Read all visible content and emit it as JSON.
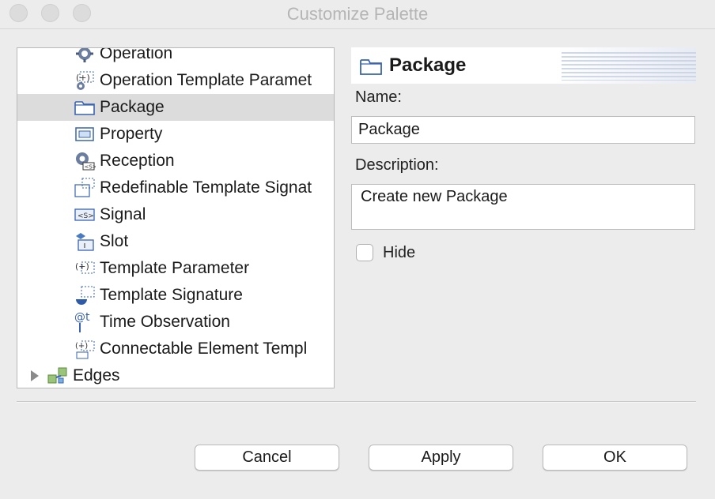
{
  "window": {
    "title": "Customize Palette"
  },
  "tree": {
    "items": [
      {
        "label": "Operation",
        "icon": "operation-gear-icon"
      },
      {
        "label": "Operation Template Paramet",
        "icon": "operation-template-parameter-icon"
      },
      {
        "label": "Package",
        "icon": "package-folder-icon",
        "selected": true
      },
      {
        "label": "Property",
        "icon": "property-icon"
      },
      {
        "label": "Reception",
        "icon": "reception-gear-icon"
      },
      {
        "label": "Redefinable Template Signat",
        "icon": "redefinable-template-signature-icon"
      },
      {
        "label": "Signal",
        "icon": "signal-icon"
      },
      {
        "label": "Slot",
        "icon": "slot-icon"
      },
      {
        "label": "Template Parameter",
        "icon": "template-parameter-icon"
      },
      {
        "label": "Template Signature",
        "icon": "template-signature-icon"
      },
      {
        "label": "Time Observation",
        "icon": "time-observation-icon"
      },
      {
        "label": "Connectable Element Templ",
        "icon": "connectable-element-template-icon"
      }
    ],
    "edges_group": {
      "label": "Edges",
      "icon": "edges-icon",
      "expanded": false
    }
  },
  "details": {
    "header_title": "Package",
    "header_icon": "package-folder-icon",
    "name_label": "Name:",
    "name_value": "Package",
    "description_label": "Description:",
    "description_value": "Create new Package",
    "hide_label": "Hide",
    "hide_checked": false
  },
  "buttons": {
    "cancel": "Cancel",
    "apply": "Apply",
    "ok": "OK"
  },
  "colors": {
    "selection": "#dcdcdc",
    "icon_blue": "#3a63b0"
  }
}
